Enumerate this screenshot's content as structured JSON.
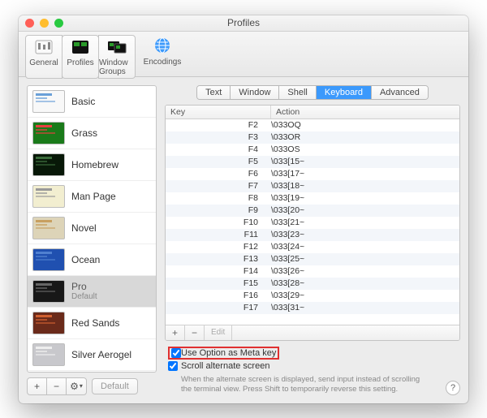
{
  "window": {
    "title": "Profiles"
  },
  "toolbar": {
    "items": [
      {
        "label": "General"
      },
      {
        "label": "Profiles"
      },
      {
        "label": "Window Groups"
      }
    ],
    "encodings_label": "Encodings"
  },
  "sidebar": {
    "profiles": [
      {
        "name": "Basic",
        "thumb_bg": "#f8f8f8",
        "thumb_fg": "#6aa0d8"
      },
      {
        "name": "Grass",
        "thumb_bg": "#1a7a1a",
        "thumb_fg": "#e84040"
      },
      {
        "name": "Homebrew",
        "thumb_bg": "#081808",
        "thumb_fg": "#3a6a3a"
      },
      {
        "name": "Man Page",
        "thumb_bg": "#f2eed0",
        "thumb_fg": "#999"
      },
      {
        "name": "Novel",
        "thumb_bg": "#ddd4b8",
        "thumb_fg": "#c8a060"
      },
      {
        "name": "Ocean",
        "thumb_bg": "#2050b0",
        "thumb_fg": "#5080d0"
      },
      {
        "name": "Pro",
        "sub": "Default",
        "thumb_bg": "#181818",
        "thumb_fg": "#666",
        "selected": true
      },
      {
        "name": "Red Sands",
        "thumb_bg": "#6a2a1a",
        "thumb_fg": "#d06030"
      },
      {
        "name": "Silver Aerogel",
        "thumb_bg": "#c8c8cc",
        "thumb_fg": "#eee"
      }
    ],
    "footer": {
      "add": "+",
      "remove": "−",
      "gear": "⚙",
      "default_label": "Default"
    }
  },
  "tabs": [
    {
      "label": "Text"
    },
    {
      "label": "Window"
    },
    {
      "label": "Shell"
    },
    {
      "label": "Keyboard",
      "active": true
    },
    {
      "label": "Advanced"
    }
  ],
  "table": {
    "header": {
      "key": "Key",
      "action": "Action"
    },
    "rows": [
      {
        "key": "F2",
        "action": "\\033OQ"
      },
      {
        "key": "F3",
        "action": "\\033OR"
      },
      {
        "key": "F4",
        "action": "\\033OS"
      },
      {
        "key": "F5",
        "action": "\\033[15~"
      },
      {
        "key": "F6",
        "action": "\\033[17~"
      },
      {
        "key": "F7",
        "action": "\\033[18~"
      },
      {
        "key": "F8",
        "action": "\\033[19~"
      },
      {
        "key": "F9",
        "action": "\\033[20~"
      },
      {
        "key": "F10",
        "action": "\\033[21~"
      },
      {
        "key": "F11",
        "action": "\\033[23~"
      },
      {
        "key": "F12",
        "action": "\\033[24~"
      },
      {
        "key": "F13",
        "action": "\\033[25~"
      },
      {
        "key": "F14",
        "action": "\\033[26~"
      },
      {
        "key": "F15",
        "action": "\\033[28~"
      },
      {
        "key": "F16",
        "action": "\\033[29~"
      },
      {
        "key": "F17",
        "action": "\\033[31~"
      }
    ],
    "footer": {
      "add": "+",
      "remove": "−",
      "edit": "Edit"
    }
  },
  "options": {
    "meta_key": "Use Option as Meta key",
    "scroll_alt": "Scroll alternate screen",
    "help_text": "When the alternate screen is displayed, send input instead of scrolling the terminal view. Press Shift to temporarily reverse this setting."
  }
}
